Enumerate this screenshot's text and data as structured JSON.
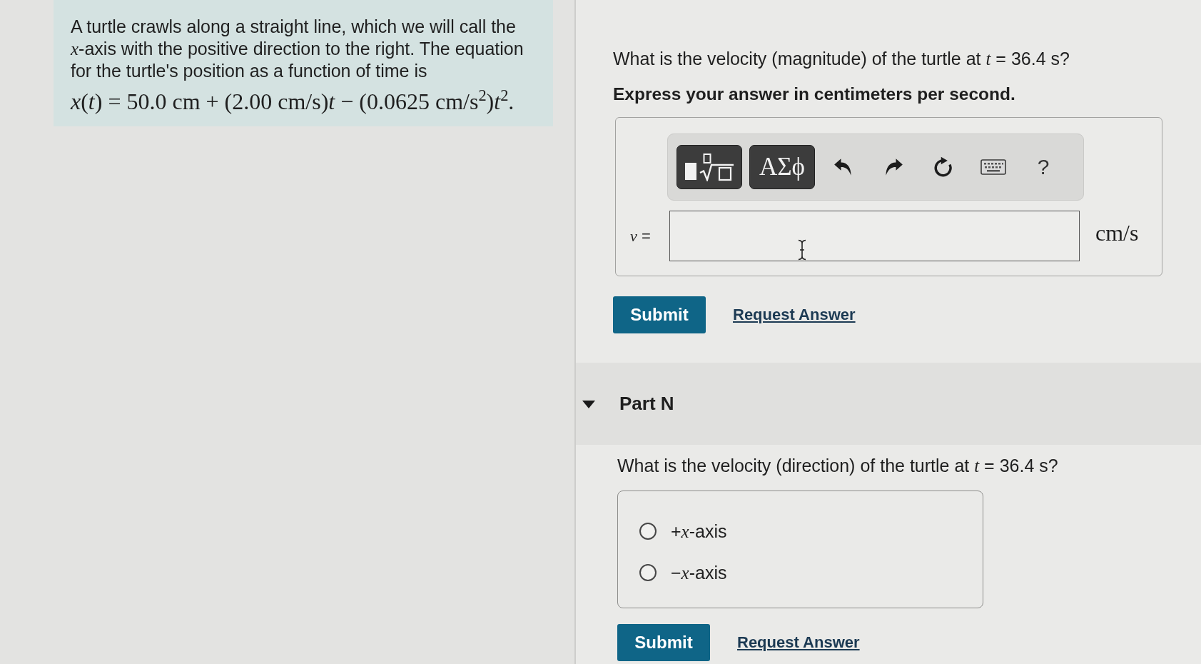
{
  "problem": {
    "text": "A turtle crawls along a straight line, which we will call the *x*-axis with the positive direction to the right. The equation for the turtle's position as a function of time is",
    "equation": "*x*(*t*) = 50.0 cm + (2.00 cm/s)*t* − (0.0625 cm/s$^{2}$)*t*$^{2}$."
  },
  "parts": [
    {
      "kind": "numeric",
      "question": "What is the velocity (magnitude) of the turtle at *t* = 36.4 s?",
      "instruction": "Express your answer in centimeters per second.",
      "toolbar": [
        {
          "kind": "template"
        },
        {
          "kind": "symbols",
          "label": "ΑΣϕ"
        },
        {
          "kind": "undo"
        },
        {
          "kind": "redo"
        },
        {
          "kind": "reset"
        },
        {
          "kind": "keyboard"
        },
        {
          "kind": "help",
          "label": "?"
        }
      ],
      "answer": {
        "label": "*v* =",
        "unit": "cm/s"
      },
      "submit": "Submit",
      "request": "Request Answer"
    },
    {
      "kind": "multiple_choice",
      "title": "Part N",
      "expanded": true,
      "question": "What is the velocity (direction) of the turtle at *t* = 36.4 s?",
      "choices": [
        {
          "label": "+*x*-axis",
          "selected": false
        },
        {
          "label": "−*x*-axis",
          "selected": false
        }
      ],
      "submit": "Submit",
      "request": "Request Answer"
    }
  ]
}
